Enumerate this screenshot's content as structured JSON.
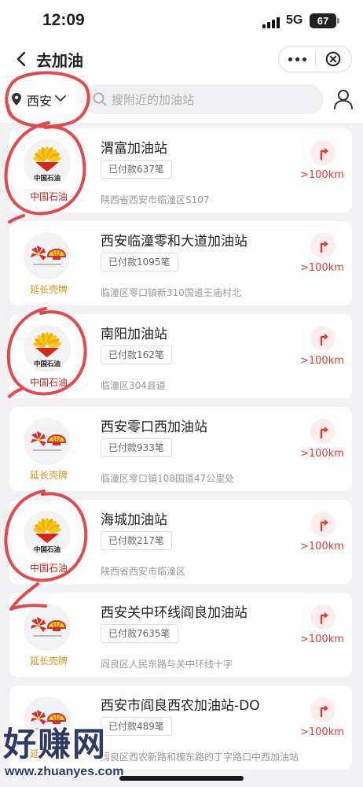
{
  "status_bar": {
    "time": "12:09",
    "network": "5G",
    "battery": "67"
  },
  "nav": {
    "title": "去加油",
    "icons": [
      "back-icon",
      "more-icon",
      "close-icon"
    ]
  },
  "search": {
    "city": "西安",
    "placeholder": "搜附近的加油站",
    "icons": [
      "location-icon",
      "chevron-down-icon",
      "search-icon",
      "user-icon"
    ]
  },
  "stations": [
    {
      "name": "渭富加油站",
      "payments": "已付款637笔",
      "address": "陕西省西安市临潼区S107",
      "distance": ">100km",
      "brand": "中国石油",
      "brand_type": "cnpc"
    },
    {
      "name": "西安临潼零和大道加油站",
      "payments": "已付款1095笔",
      "address": "临潼区零口镇新310国道王庙村北",
      "distance": ">100km",
      "brand": "延长壳牌",
      "brand_type": "yanchang-shell"
    },
    {
      "name": "南阳加油站",
      "payments": "已付款162笔",
      "address": "临潼区304县道",
      "distance": ">100km",
      "brand": "中国石油",
      "brand_type": "cnpc"
    },
    {
      "name": "西安零口西加油站",
      "payments": "已付款933笔",
      "address": "临潼区零口镇108国道47公里处",
      "distance": ">100km",
      "brand": "延长壳牌",
      "brand_type": "yanchang-shell"
    },
    {
      "name": "海城加油站",
      "payments": "已付款217笔",
      "address": "陕西省西安市临潼区",
      "distance": ">100km",
      "brand": "中国石油",
      "brand_type": "cnpc"
    },
    {
      "name": "西安关中环线阎良加油站",
      "payments": "已付款7635笔",
      "address": "阎良区人民东路与关中环线十字",
      "distance": ">100km",
      "brand": "延长壳牌",
      "brand_type": "yanchang-shell"
    },
    {
      "name": "西安市阎良西农加油站-DO",
      "payments": "已付款489笔",
      "address": "阎良区西农新路和槐东路的丁字路口中西加油站",
      "distance": ">100km",
      "brand": "延长壳牌",
      "brand_type": "yanchang-shell"
    }
  ],
  "logo_text": {
    "cnpc": "中国石油"
  },
  "watermark": {
    "title": "好赚网",
    "url": "www.zhuanyes.com"
  },
  "colors": {
    "accent": "#e33a36",
    "cnpc_red": "#c4261d",
    "yanchang_gold": "#d89316",
    "annotation": "#e0363a"
  }
}
